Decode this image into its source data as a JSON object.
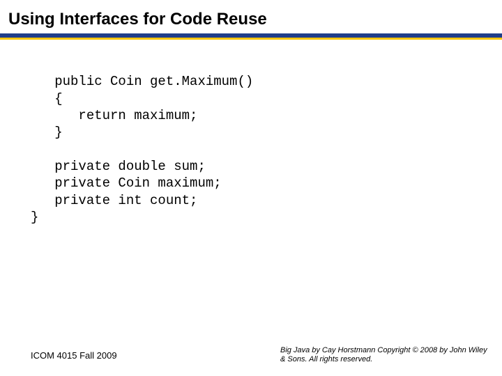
{
  "title": "Using Interfaces for Code Reuse",
  "code": {
    "l1": "   public Coin get.Maximum()",
    "l2": "   {",
    "l3": "      return maximum;",
    "l4": "   }",
    "blank1": "",
    "l5": "   private double sum;",
    "l6": "   private Coin maximum;",
    "l7": "   private int count;",
    "l8": "}"
  },
  "footer": {
    "left": "ICOM 4015 Fall 2009",
    "right": "Big Java by Cay Horstmann Copyright © 2008 by John Wiley & Sons.  All rights reserved."
  }
}
